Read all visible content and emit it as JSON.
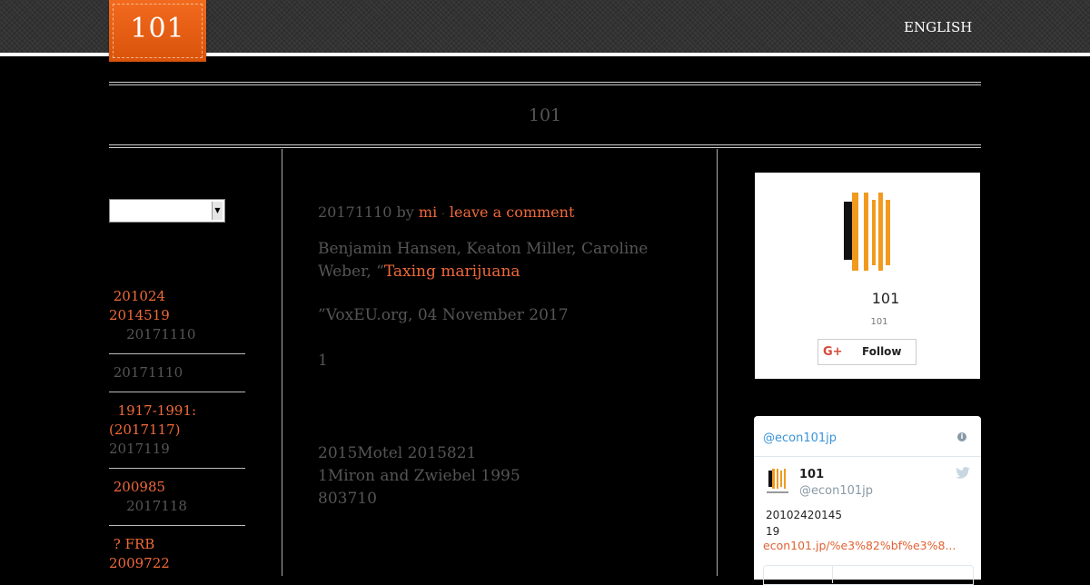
{
  "header": {
    "logo_text": "101",
    "language_label": "ENGLISH"
  },
  "site": {
    "title": "101"
  },
  "sidebar": {
    "select_value": "",
    "items": [
      {
        "title_lines": [
          " 201024",
          "2014519"
        ],
        "meta": "    20171110"
      },
      {
        "title_lines": [],
        "meta": " 20171110"
      },
      {
        "title_lines": [
          "  1917-1991:",
          "(2017117)"
        ],
        "meta": "2017119"
      },
      {
        "title_lines": [
          " 200985"
        ],
        "meta": "    2017118"
      },
      {
        "title_lines": [
          " ? FRB",
          "2009722"
        ],
        "meta": ""
      }
    ]
  },
  "post": {
    "date": "20171110",
    "by": "by",
    "author": "mi",
    "dot": "·",
    "comment_link": "leave a comment",
    "citation_authors_line1": "Benjamin Hansen, Keaton Miller, Caroline",
    "citation_authors_line2": "Weber, “",
    "citation_title": "Taxing marijuana",
    "citation_source": "”VoxEU.org, 04 November 2017",
    "paragraph_1": "1",
    "paragraph_2_line1": "2015Motel 2015821",
    "paragraph_2_line2": "1Miron and Zwiebel 1995",
    "paragraph_2_line3": "803710"
  },
  "gplus_widget": {
    "name": "101",
    "subtitle": "101",
    "follow_label": "Follow",
    "g_label": "G+"
  },
  "twitter_widget": {
    "header_handle": "@econ101jp",
    "info_icon": "i",
    "display_name": "101",
    "username": "@econ101jp",
    "tweet_line1": "20102420145",
    "tweet_line2": "19",
    "tweet_link": "econ101.jp/%e3%82%bf%e3%8..."
  },
  "colors": {
    "accent": "#f0693a",
    "logo_orange": "#f26a1e",
    "twitter_blue": "#3b94d9",
    "background": "#000000"
  }
}
